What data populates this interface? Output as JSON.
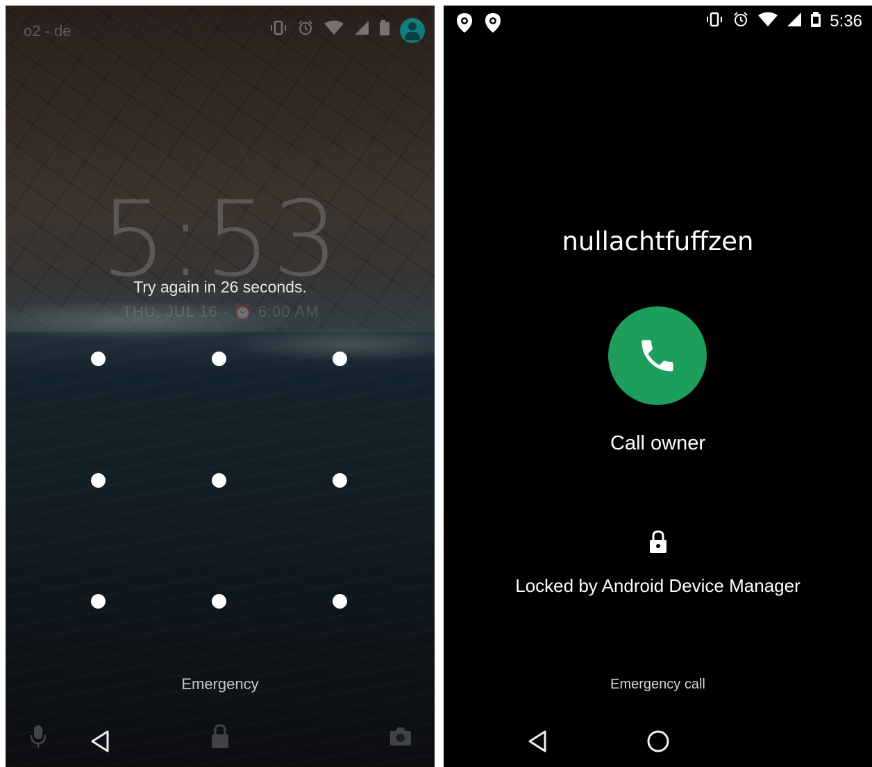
{
  "left_screen": {
    "status_bar": {
      "carrier": "o2 - de",
      "icons": [
        "vibrate-icon",
        "alarm-icon",
        "wifi-icon",
        "signal-icon",
        "battery-icon",
        "user-avatar"
      ]
    },
    "clock": "5:53",
    "date_line": "THU, JUL 16 · ⏰ 6:00 AM",
    "message": "Try again in 26 seconds.",
    "pattern_dots": 9,
    "emergency_label": "Emergency",
    "bottom_icons": [
      "microphone-icon",
      "back-icon",
      "lock-icon",
      "camera-icon"
    ]
  },
  "right_screen": {
    "status_bar": {
      "left_icons": [
        "location-pin-icon",
        "location-pin-icon"
      ],
      "right_icons": [
        "vibrate-icon",
        "alarm-icon",
        "wifi-icon",
        "signal-icon",
        "battery-icon"
      ],
      "time": "5:36"
    },
    "owner_name": "nullachtfuffzen",
    "call_button_label": "Call owner",
    "locked_message": "Locked by Android Device Manager",
    "emergency_call_label": "Emergency call",
    "nav_icons": [
      "back-icon",
      "home-icon"
    ],
    "colors": {
      "call_button": "#1e9e5c"
    }
  }
}
